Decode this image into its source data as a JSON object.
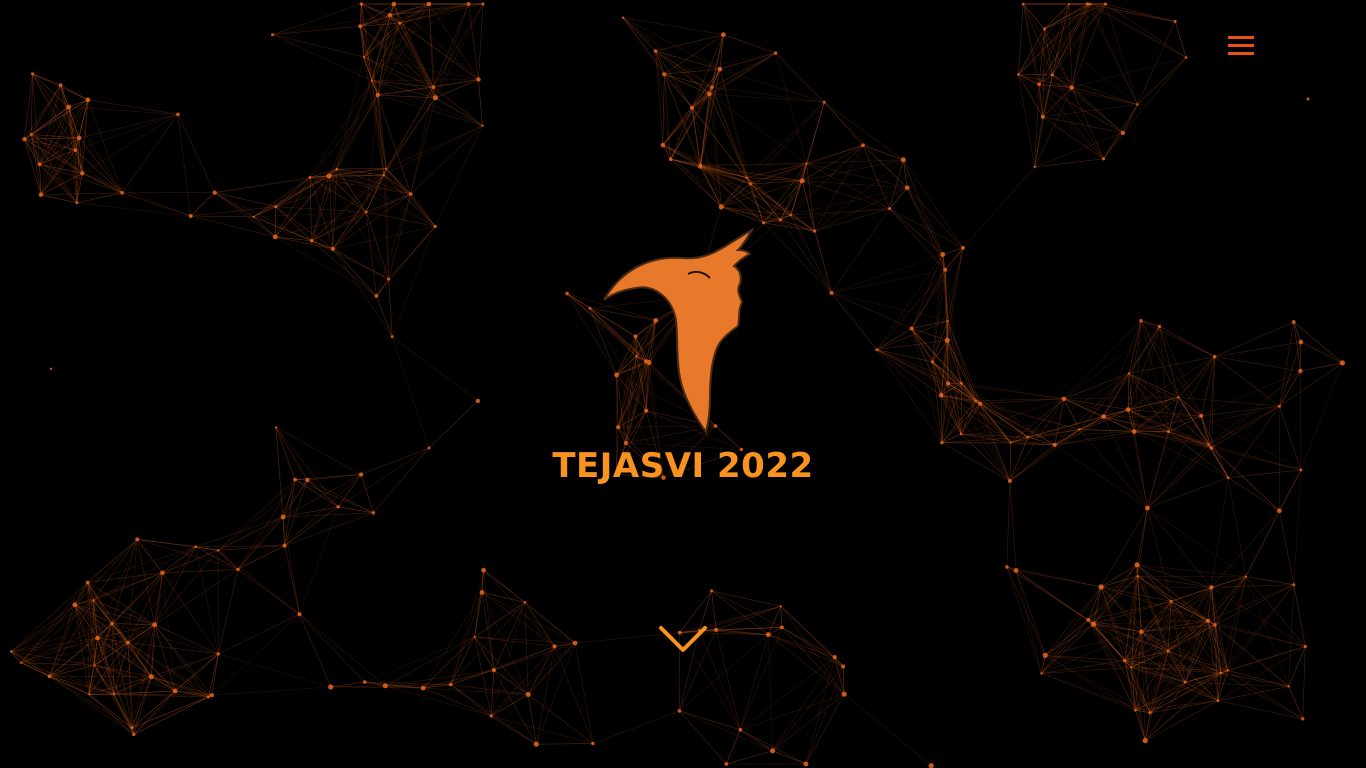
{
  "page": {
    "background": "#000000",
    "network_color": "#e8661c"
  },
  "header": {
    "menu_icon": "hamburger-menu-icon",
    "menu_color": "#e8501c"
  },
  "hero": {
    "logo_icon": "phoenix-flame-logo",
    "logo_color": "#e8792a",
    "title": "TEJASVI 2022",
    "title_color": "#f7931e"
  },
  "scroll": {
    "icon": "chevron-down-icon",
    "color": "#f7931e"
  }
}
